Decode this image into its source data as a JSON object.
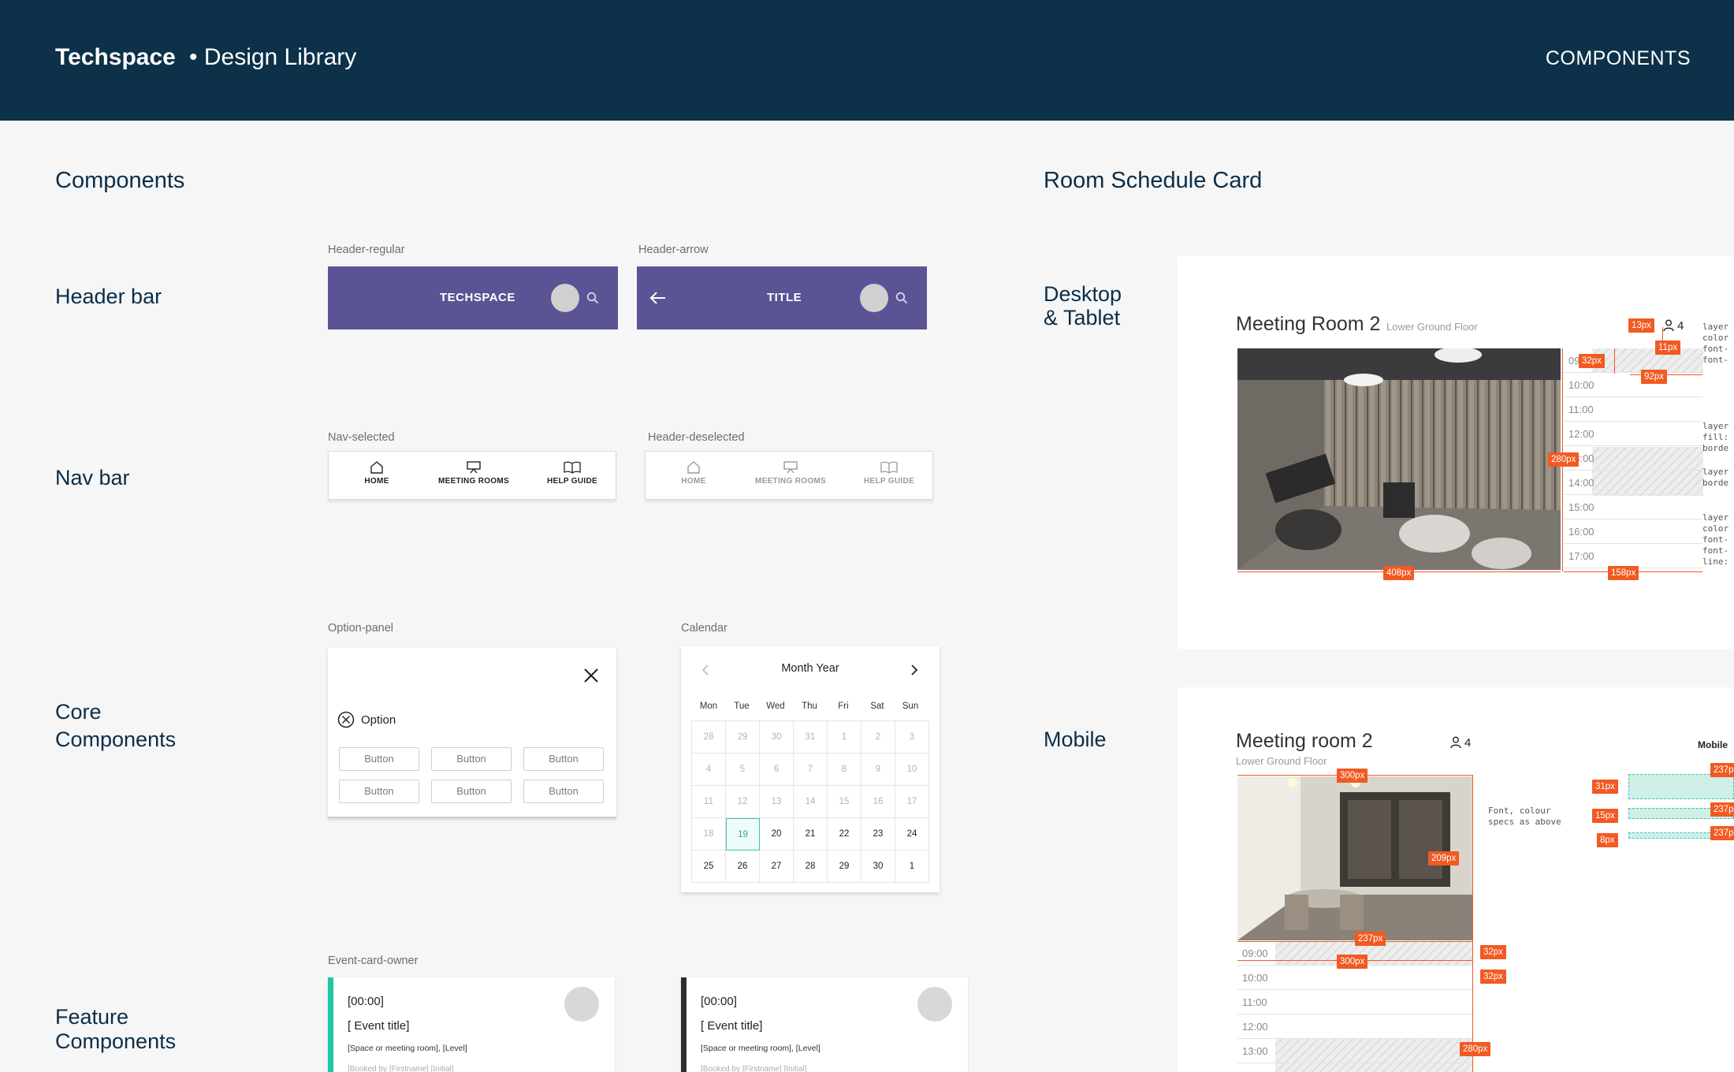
{
  "header": {
    "brand": "Techspace",
    "subtitle": "• Design Library",
    "right_label": "COMPONENTS"
  },
  "left": {
    "section_title": "Components",
    "rows": {
      "header_bar": "Header bar",
      "nav_bar": "Nav bar",
      "core_1": "Core",
      "core_2": "Components",
      "feature_1": "Feature",
      "feature_2": "Components"
    },
    "header_regular": {
      "caption": "Header-regular",
      "title": "TECHSPACE"
    },
    "header_arrow": {
      "caption": "Header-arrow",
      "title": "TITLE"
    },
    "nav_selected": {
      "caption": "Nav-selected",
      "items": [
        "HOME",
        "MEETING ROOMS",
        "HELP GUIDE"
      ]
    },
    "nav_deselected": {
      "caption": "Header-deselected",
      "items": [
        "HOME",
        "MEETING ROOMS",
        "HELP GUIDE"
      ]
    },
    "option_panel": {
      "caption": "Option-panel",
      "option_label": "Option",
      "buttons": [
        "Button",
        "Button",
        "Button",
        "Button",
        "Button",
        "Button"
      ]
    },
    "calendar": {
      "caption": "Calendar",
      "month_label": "Month Year",
      "weekdays": [
        "Mon",
        "Tue",
        "Wed",
        "Thu",
        "Fri",
        "Sat",
        "Sun"
      ],
      "weeks": [
        [
          "28",
          "29",
          "30",
          "31",
          "1",
          "2",
          "3"
        ],
        [
          "4",
          "5",
          "6",
          "7",
          "8",
          "9",
          "10"
        ],
        [
          "11",
          "12",
          "13",
          "14",
          "15",
          "16",
          "17"
        ],
        [
          "18",
          "19",
          "20",
          "21",
          "22",
          "23",
          "24"
        ],
        [
          "25",
          "26",
          "27",
          "28",
          "29",
          "30",
          "1"
        ]
      ],
      "selected": "19"
    },
    "event_cards": {
      "caption": "Event-card-owner",
      "cards": [
        {
          "time": "[00:00]",
          "title": "[ Event title]",
          "location": "[Space or meeting room], [Level]",
          "booked_by": "[Booked by [Firstname] [Initial]",
          "accent": "#1fc8a5"
        },
        {
          "time": "[00:00]",
          "title": "[ Event title]",
          "location": "[Space or meeting room], [Level]",
          "booked_by": "[Booked by [Firstname] [Initial]",
          "accent": "#2d2d33"
        }
      ]
    }
  },
  "right": {
    "section_title": "Room Schedule Card",
    "desktop_label_1": "Desktop",
    "desktop_label_2": "& Tablet",
    "mobile_label": "Mobile",
    "desktop_card": {
      "room": "Meeting Room 2",
      "floor": "Lower Ground Floor",
      "capacity": "4",
      "times": [
        "09:00",
        "10:00",
        "11:00",
        "12:00",
        "13:00",
        "14:00",
        "15:00",
        "16:00",
        "17:00"
      ],
      "specs": [
        "13px",
        "11px",
        "32px",
        "92px",
        "280px",
        "408px",
        "158px"
      ],
      "notes": [
        "layer",
        "color",
        "font-",
        "font-",
        "layer",
        "fill:",
        "borde",
        "layer",
        "borde",
        "layer",
        "color",
        "font-",
        "font-",
        "line:"
      ]
    },
    "mobile_card": {
      "room": "Meeting room 2",
      "floor": "Lower Ground Floor",
      "capacity": "4",
      "times": [
        "09:00",
        "10:00",
        "11:00",
        "12:00",
        "13:00"
      ],
      "specs": [
        "300px",
        "209px",
        "237px",
        "300px",
        "32px",
        "32px",
        "280px"
      ],
      "side_title": "Mobile",
      "side_specs": [
        "31px",
        "15px",
        "8px",
        "237p",
        "237p",
        "237p"
      ],
      "note": "Font, colour specs as above"
    }
  },
  "colors": {
    "header_bg": "#0c3149",
    "purple": "#5a5495",
    "spec_orange": "#f15a22",
    "teal": "#35c6b6"
  }
}
